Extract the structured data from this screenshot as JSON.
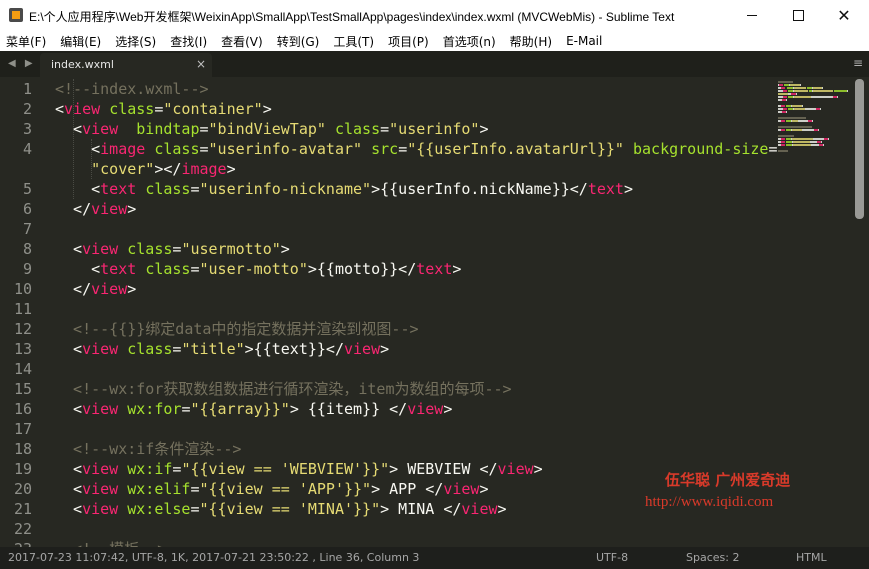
{
  "window": {
    "title": "E:\\个人应用程序\\Web开发框架\\WeixinApp\\SmallApp\\TestSmallApp\\pages\\index\\index.wxml (MVCWebMis) - Sublime Text",
    "minimize_glyph": "—",
    "maximize_glyph": "☐",
    "close_glyph": "✕"
  },
  "menu": [
    "菜单(F)",
    "编辑(E)",
    "选择(S)",
    "查找(I)",
    "查看(V)",
    "转到(G)",
    "工具(T)",
    "项目(P)",
    "首选项(n)",
    "帮助(H)",
    "E-Mail"
  ],
  "tabs": {
    "nav": "◀ ▶",
    "active": "index.wxml",
    "close": "×",
    "menu": "≡"
  },
  "code": [
    {
      "n": "1",
      "parts": [
        {
          "k": "c",
          "t": "<!--index.wxml-->"
        }
      ]
    },
    {
      "n": "2",
      "parts": [
        {
          "k": "",
          "t": "<"
        },
        {
          "k": "t",
          "t": "view"
        },
        {
          "k": "",
          "t": " "
        },
        {
          "k": "a",
          "t": "class"
        },
        {
          "k": "",
          "t": "="
        },
        {
          "k": "s",
          "t": "\"container\""
        },
        {
          "k": "",
          "t": ">"
        }
      ]
    },
    {
      "n": "3",
      "parts": [
        {
          "k": "",
          "t": "  <"
        },
        {
          "k": "t",
          "t": "view"
        },
        {
          "k": "",
          "t": "  "
        },
        {
          "k": "a",
          "t": "bindtap"
        },
        {
          "k": "",
          "t": "="
        },
        {
          "k": "s",
          "t": "\"bindViewTap\""
        },
        {
          "k": "",
          "t": " "
        },
        {
          "k": "a",
          "t": "class"
        },
        {
          "k": "",
          "t": "="
        },
        {
          "k": "s",
          "t": "\"userinfo\""
        },
        {
          "k": "",
          "t": ">"
        }
      ]
    },
    {
      "n": "4",
      "parts": [
        {
          "k": "",
          "t": "    <"
        },
        {
          "k": "t",
          "t": "image"
        },
        {
          "k": "",
          "t": " "
        },
        {
          "k": "a",
          "t": "class"
        },
        {
          "k": "",
          "t": "="
        },
        {
          "k": "s",
          "t": "\"userinfo-avatar\""
        },
        {
          "k": "",
          "t": " "
        },
        {
          "k": "a",
          "t": "src"
        },
        {
          "k": "",
          "t": "="
        },
        {
          "k": "s",
          "t": "\"{{userInfo.avatarUrl}}\""
        },
        {
          "k": "",
          "t": " "
        },
        {
          "k": "a",
          "t": "background-size"
        },
        {
          "k": "",
          "t": "="
        }
      ]
    },
    {
      "n": "",
      "parts": [
        {
          "k": "s",
          "t": "    \"cover\""
        },
        {
          "k": "",
          "t": "></"
        },
        {
          "k": "t",
          "t": "image"
        },
        {
          "k": "",
          "t": ">"
        }
      ]
    },
    {
      "n": "5",
      "parts": [
        {
          "k": "",
          "t": "    <"
        },
        {
          "k": "t",
          "t": "text"
        },
        {
          "k": "",
          "t": " "
        },
        {
          "k": "a",
          "t": "class"
        },
        {
          "k": "",
          "t": "="
        },
        {
          "k": "s",
          "t": "\"userinfo-nickname\""
        },
        {
          "k": "",
          "t": ">{{userInfo.nickName}}</"
        },
        {
          "k": "t",
          "t": "text"
        },
        {
          "k": "",
          "t": ">"
        }
      ]
    },
    {
      "n": "6",
      "parts": [
        {
          "k": "",
          "t": "  </"
        },
        {
          "k": "t",
          "t": "view"
        },
        {
          "k": "",
          "t": ">"
        }
      ]
    },
    {
      "n": "7",
      "parts": [
        {
          "k": "",
          "t": ""
        }
      ]
    },
    {
      "n": "8",
      "parts": [
        {
          "k": "",
          "t": "  <"
        },
        {
          "k": "t",
          "t": "view"
        },
        {
          "k": "",
          "t": " "
        },
        {
          "k": "a",
          "t": "class"
        },
        {
          "k": "",
          "t": "="
        },
        {
          "k": "s",
          "t": "\"usermotto\""
        },
        {
          "k": "",
          "t": ">"
        }
      ]
    },
    {
      "n": "9",
      "parts": [
        {
          "k": "",
          "t": "    <"
        },
        {
          "k": "t",
          "t": "text"
        },
        {
          "k": "",
          "t": " "
        },
        {
          "k": "a",
          "t": "class"
        },
        {
          "k": "",
          "t": "="
        },
        {
          "k": "s",
          "t": "\"user-motto\""
        },
        {
          "k": "",
          "t": ">{{motto}}</"
        },
        {
          "k": "t",
          "t": "text"
        },
        {
          "k": "",
          "t": ">"
        }
      ]
    },
    {
      "n": "10",
      "parts": [
        {
          "k": "",
          "t": "  </"
        },
        {
          "k": "t",
          "t": "view"
        },
        {
          "k": "",
          "t": ">"
        }
      ]
    },
    {
      "n": "11",
      "parts": [
        {
          "k": "",
          "t": ""
        }
      ]
    },
    {
      "n": "12",
      "parts": [
        {
          "k": "c",
          "t": "  <!--{{}}绑定data中的指定数据并渲染到视图-->"
        }
      ]
    },
    {
      "n": "13",
      "parts": [
        {
          "k": "",
          "t": "  <"
        },
        {
          "k": "t",
          "t": "view"
        },
        {
          "k": "",
          "t": " "
        },
        {
          "k": "a",
          "t": "class"
        },
        {
          "k": "",
          "t": "="
        },
        {
          "k": "s",
          "t": "\"title\""
        },
        {
          "k": "",
          "t": ">{{text}}</"
        },
        {
          "k": "t",
          "t": "view"
        },
        {
          "k": "",
          "t": ">"
        }
      ]
    },
    {
      "n": "14",
      "parts": [
        {
          "k": "",
          "t": ""
        }
      ]
    },
    {
      "n": "15",
      "parts": [
        {
          "k": "c",
          "t": "  <!--wx:for获取数组数据进行循环渲染，item为数组的每项-->"
        }
      ]
    },
    {
      "n": "16",
      "parts": [
        {
          "k": "",
          "t": "  <"
        },
        {
          "k": "t",
          "t": "view"
        },
        {
          "k": "",
          "t": " "
        },
        {
          "k": "a",
          "t": "wx:for"
        },
        {
          "k": "",
          "t": "="
        },
        {
          "k": "s",
          "t": "\"{{array}}\""
        },
        {
          "k": "",
          "t": "> {{item}} </"
        },
        {
          "k": "t",
          "t": "view"
        },
        {
          "k": "",
          "t": ">"
        }
      ]
    },
    {
      "n": "17",
      "parts": [
        {
          "k": "",
          "t": ""
        }
      ]
    },
    {
      "n": "18",
      "parts": [
        {
          "k": "c",
          "t": "  <!--wx:if条件渲染-->"
        }
      ]
    },
    {
      "n": "19",
      "parts": [
        {
          "k": "",
          "t": "  <"
        },
        {
          "k": "t",
          "t": "view"
        },
        {
          "k": "",
          "t": " "
        },
        {
          "k": "a",
          "t": "wx:if"
        },
        {
          "k": "",
          "t": "="
        },
        {
          "k": "s",
          "t": "\"{{view == 'WEBVIEW'}}\""
        },
        {
          "k": "",
          "t": "> WEBVIEW </"
        },
        {
          "k": "t",
          "t": "view"
        },
        {
          "k": "",
          "t": ">"
        }
      ]
    },
    {
      "n": "20",
      "parts": [
        {
          "k": "",
          "t": "  <"
        },
        {
          "k": "t",
          "t": "view"
        },
        {
          "k": "",
          "t": " "
        },
        {
          "k": "a",
          "t": "wx:elif"
        },
        {
          "k": "",
          "t": "="
        },
        {
          "k": "s",
          "t": "\"{{view == 'APP'}}\""
        },
        {
          "k": "",
          "t": "> APP </"
        },
        {
          "k": "t",
          "t": "view"
        },
        {
          "k": "",
          "t": ">"
        }
      ]
    },
    {
      "n": "21",
      "parts": [
        {
          "k": "",
          "t": "  <"
        },
        {
          "k": "t",
          "t": "view"
        },
        {
          "k": "",
          "t": " "
        },
        {
          "k": "a",
          "t": "wx:else"
        },
        {
          "k": "",
          "t": "="
        },
        {
          "k": "s",
          "t": "\"{{view == 'MINA'}}\""
        },
        {
          "k": "",
          "t": "> MINA </"
        },
        {
          "k": "t",
          "t": "view"
        },
        {
          "k": "",
          "t": ">"
        }
      ]
    },
    {
      "n": "22",
      "parts": [
        {
          "k": "",
          "t": ""
        }
      ]
    },
    {
      "n": "23",
      "parts": [
        {
          "k": "c",
          "t": "  <!--模板-->"
        }
      ]
    }
  ],
  "watermark": {
    "name": "伍华聪 广州爱奇迪",
    "url": "http://www.iqidi.com"
  },
  "status": {
    "info": "2017-07-23 11:07:42, UTF-8, 1K, 2017-07-21 23:50:22 , Line 36, Column 3",
    "encoding": "UTF-8",
    "spaces": "Spaces: 2",
    "syntax": "HTML"
  },
  "colors": {
    "background": "#272822",
    "tag": "#f92672",
    "attribute": "#a6e22e",
    "string": "#e6db74",
    "comment": "#75715e",
    "text": "#f8f8f2"
  }
}
